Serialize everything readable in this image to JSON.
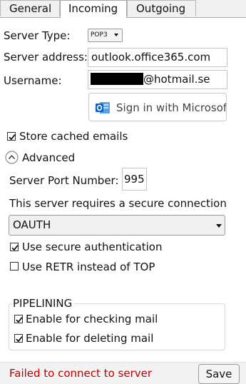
{
  "tabs": [
    {
      "label": "General"
    },
    {
      "label": "Incoming"
    },
    {
      "label": "Outgoing"
    }
  ],
  "server_type": {
    "label": "Server Type:",
    "value": "POP3"
  },
  "server_address": {
    "label": "Server address:",
    "value": "outlook.office365.com"
  },
  "username": {
    "label": "Username:",
    "value_visible": "@hotmail.se"
  },
  "sign_in_button": {
    "label": "Sign in with Microsoft"
  },
  "store_cached": {
    "label": "Store cached emails",
    "checked": true
  },
  "advanced": {
    "label": "Advanced",
    "expanded": true
  },
  "server_port": {
    "label": "Server Port Number:",
    "value": "995"
  },
  "secure_connection": {
    "label": "This server requires a secure connection",
    "value": "OAUTH"
  },
  "secure_auth": {
    "label": "Use secure authentication",
    "checked": true
  },
  "retr": {
    "label": "Use RETR instead of TOP",
    "checked": false
  },
  "pipelining": {
    "title": "PIPELINING",
    "checking": {
      "label": "Enable for checking mail",
      "checked": true
    },
    "deleting": {
      "label": "Enable for deleting mail",
      "checked": true
    }
  },
  "status": {
    "text": "Failed to connect to server",
    "color": "#c00000"
  },
  "save_button": {
    "label": "Save"
  }
}
